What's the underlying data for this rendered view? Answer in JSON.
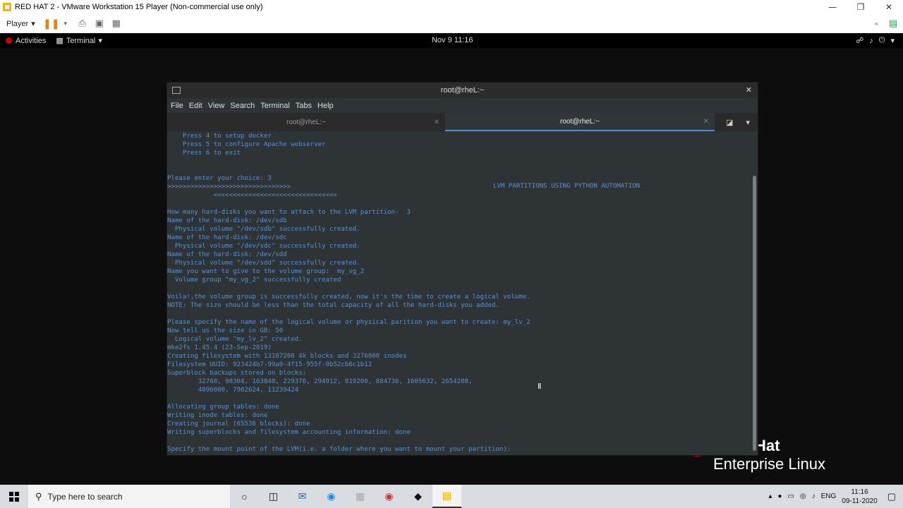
{
  "vmware": {
    "title": "RED HAT 2 - VMware Workstation 15 Player (Non-commercial use only)",
    "player_label": "Player"
  },
  "gnome": {
    "activities_label": "Activities",
    "app_label": "Terminal",
    "clock": "Nov 9  11:16"
  },
  "terminal": {
    "window_title": "root@rheL:~",
    "menu": [
      "File",
      "Edit",
      "View",
      "Search",
      "Terminal",
      "Tabs",
      "Help"
    ],
    "tabs": [
      {
        "label": "root@rheL:~",
        "active": false
      },
      {
        "label": "root@rheL:~",
        "active": true
      }
    ],
    "banner": "LVM PARTITIONS USING PYTHON AUTOMATION",
    "lines": [
      "    Press 4 to setup docker",
      "    Press 5 to configure Apache webserver",
      "    Press 6 to exit",
      "",
      "",
      "Please enter your choice: 3",
      ">>>>>>>>>>>>>>>>>>>>>>>>>>>>>>>>",
      "            <<<<<<<<<<<<<<<<<<<<<<<<<<<<<<<<",
      "",
      "How many hard-disks you want to attach to the LVM partition-  3",
      "Name of the hard-disk: /dev/sdb",
      "  Physical volume \"/dev/sdb\" successfully created.",
      "Name of the hard-disk: /dev/sdc",
      "  Physical volume \"/dev/sdc\" successfully created.",
      "Name of the hard-disk: /dev/sdd",
      "  Physical volume \"/dev/sdd\" successfully created.",
      "Name you want to give to the volume group:  my_vg_2",
      "  Volume group \"my_vg_2\" successfully created",
      "",
      "Voila!,the volume group is successfully created, now it's the time to create a logical volume.",
      "NOTE: The size should be less than the total capacity of all the hard-disks you added.",
      "",
      "Please specify the name of the logical volume or physical parition you want to create: my_lv_2",
      "Now tell us the size in GB: 50",
      "  Logical volume \"my_lv_2\" created.",
      "mke2fs 1.45.4 (23-Sep-2019)",
      "Creating filesystem with 13107200 4k blocks and 3276800 inodes",
      "Filesystem UUID: 923424b7-99a0-4f15-955f-0b52cb6c1b12",
      "Superblock backups stored on blocks:",
      "        32768, 98304, 163840, 229376, 294912, 819200, 884736, 1605632, 2654208,",
      "        4096000, 7962624, 11239424",
      "",
      "Allocating group tables: done",
      "Writing inode tables: done",
      "Creating journal (65536 blocks): done",
      "Writing superblocks and filesystem accounting information: done",
      "",
      "Specify the mount point of the LVM(i.e. a folder where you want to mount your partition):"
    ]
  },
  "desktop": {
    "logo_hat_word": "Hat",
    "logo_line": "Enterprise Linux"
  },
  "taskbar": {
    "search_placeholder": "Type here to search",
    "lang": "ENG",
    "time": "11:16",
    "date": "09-11-2020"
  }
}
